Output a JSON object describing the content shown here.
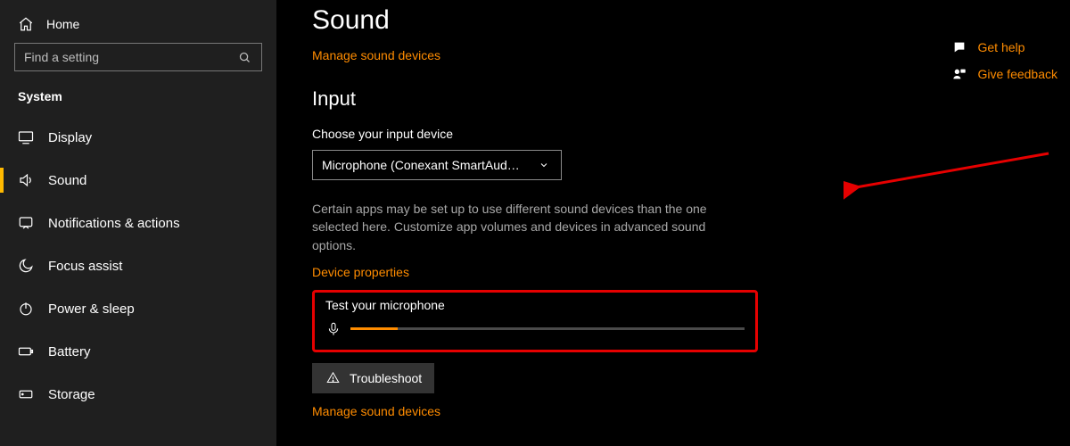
{
  "sidebar": {
    "home": "Home",
    "search_placeholder": "Find a setting",
    "breadcrumb": "System",
    "items": [
      {
        "label": "Display"
      },
      {
        "label": "Sound"
      },
      {
        "label": "Notifications & actions"
      },
      {
        "label": "Focus assist"
      },
      {
        "label": "Power & sleep"
      },
      {
        "label": "Battery"
      },
      {
        "label": "Storage"
      }
    ]
  },
  "main": {
    "title": "Sound",
    "manage_link": "Manage sound devices",
    "section": "Input",
    "choose_label": "Choose your input device",
    "selected_device": "Microphone (Conexant SmartAud…",
    "apps_desc": "Certain apps may be set up to use different sound devices than the one selected here. Customize app volumes and devices in advanced sound options.",
    "device_props": "Device properties",
    "test_label": "Test your microphone",
    "troubleshoot": "Troubleshoot",
    "manage_link2": "Manage sound devices"
  },
  "right": {
    "help": "Get help",
    "feedback": "Give feedback"
  }
}
